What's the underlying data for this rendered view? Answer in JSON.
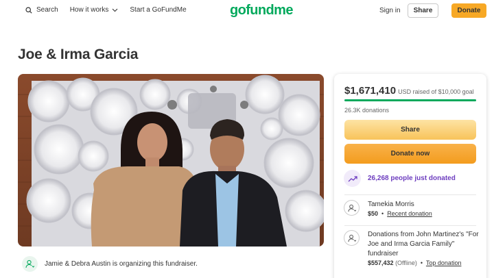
{
  "header": {
    "search_label": "Search",
    "how_it_works_label": "How it works",
    "start_label": "Start a GoFundMe",
    "logo_text": "gofundme",
    "signin_label": "Sign in",
    "share_label": "Share",
    "donate_label": "Donate"
  },
  "campaign": {
    "title": "Joe & Irma Garcia",
    "organizer_text": "Jamie & Debra Austin is organizing this fundraiser."
  },
  "donation_card": {
    "raised_amount": "$1,671,410",
    "raised_goal_text": "USD raised of $10,000 goal",
    "progress_fraction": 1.0,
    "donation_count": "26.3K donations",
    "share_label": "Share",
    "donate_now_label": "Donate now",
    "recent_activity": "26,268 people just donated",
    "donors": [
      {
        "name": "Tamekia Morris",
        "amount": "$50",
        "link_label": "Recent donation"
      },
      {
        "name": "Donations from John Martinez's \"For Joe and Irma Garcia Family\" fundraiser",
        "amount": "$557,432",
        "note": "(Offline)",
        "link_label": "Top donation"
      }
    ]
  },
  "colors": {
    "brand_green": "#02a95c",
    "donate_orange": "#f7a825",
    "share_yellow": "#f8c35a",
    "recent_purple": "#6d3dbf"
  }
}
